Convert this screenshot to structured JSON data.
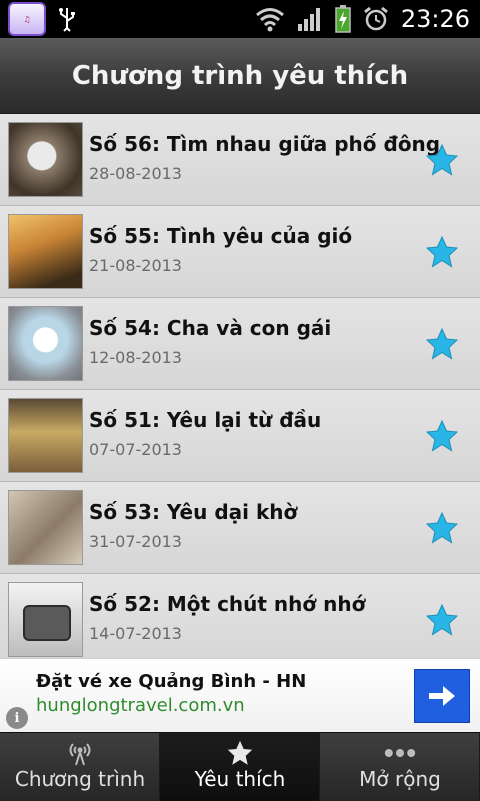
{
  "status_bar": {
    "time": "23:26",
    "icons": [
      "app-icon",
      "usb-icon",
      "wifi-icon",
      "signal-icon",
      "battery-charging-icon",
      "alarm-icon"
    ]
  },
  "title": "Chương trình yêu thích",
  "favorites": [
    {
      "title": "Số 56: Tìm nhau giữa phố đông",
      "date": "28-08-2013"
    },
    {
      "title": "Số 55: Tình yêu của gió",
      "date": "21-08-2013"
    },
    {
      "title": "Số 54: Cha và con gái",
      "date": "12-08-2013"
    },
    {
      "title": "Số 51: Yêu lại từ đầu",
      "date": "07-07-2013"
    },
    {
      "title": "Số 53: Yêu dại khờ",
      "date": "31-07-2013"
    },
    {
      "title": "Số 52: Một chút nhớ nhớ",
      "date": "14-07-2013"
    }
  ],
  "ad": {
    "title": "Đặt vé xe Quảng Bình - HN",
    "url": "hunglongtravel.com.vn"
  },
  "tabs": [
    {
      "label": "Chương trình",
      "icon": "broadcast-icon"
    },
    {
      "label": "Yêu thích",
      "icon": "star-icon",
      "active": true
    },
    {
      "label": "Mở rộng",
      "icon": "more-dots-icon"
    }
  ],
  "colors": {
    "star": "#29b6e6",
    "ad_url": "#2e8b2e",
    "ad_button": "#1f5fe0"
  }
}
